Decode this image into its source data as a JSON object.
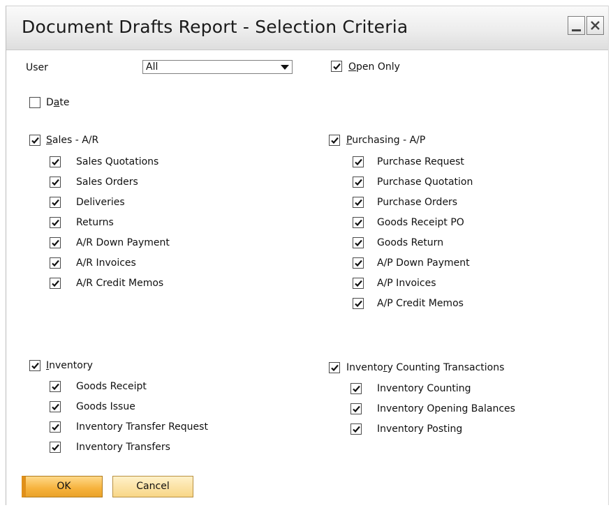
{
  "window": {
    "title": "Document Drafts Report - Selection Criteria",
    "minimize_icon": "minimize-icon",
    "close_icon": "close-icon"
  },
  "user": {
    "label": "User",
    "value": "All"
  },
  "open_only": {
    "label": "Open Only",
    "checked": true
  },
  "date": {
    "label": "Date",
    "checked": false
  },
  "sales": {
    "label": "Sales - A/R",
    "checked": true,
    "items": [
      {
        "label": "Sales Quotations",
        "checked": true
      },
      {
        "label": "Sales Orders",
        "checked": true
      },
      {
        "label": "Deliveries",
        "checked": true
      },
      {
        "label": "Returns",
        "checked": true
      },
      {
        "label": "A/R Down Payment",
        "checked": true
      },
      {
        "label": "A/R Invoices",
        "checked": true
      },
      {
        "label": "A/R Credit Memos",
        "checked": true
      }
    ]
  },
  "purchasing": {
    "label": "Purchasing - A/P",
    "checked": true,
    "items": [
      {
        "label": "Purchase Request",
        "checked": true
      },
      {
        "label": "Purchase Quotation",
        "checked": true
      },
      {
        "label": "Purchase Orders",
        "checked": true
      },
      {
        "label": "Goods Receipt PO",
        "checked": true
      },
      {
        "label": "Goods Return",
        "checked": true
      },
      {
        "label": "A/P Down Payment",
        "checked": true
      },
      {
        "label": "A/P Invoices",
        "checked": true
      },
      {
        "label": "A/P Credit Memos",
        "checked": true
      }
    ]
  },
  "inventory": {
    "label": "Inventory",
    "checked": true,
    "items": [
      {
        "label": "Goods Receipt",
        "checked": true
      },
      {
        "label": "Goods Issue",
        "checked": true
      },
      {
        "label": "Inventory Transfer Request",
        "checked": true
      },
      {
        "label": "Inventory Transfers",
        "checked": true
      }
    ]
  },
  "counting": {
    "label": "Inventory Counting Transactions",
    "checked": true,
    "items": [
      {
        "label": "Inventory Counting",
        "checked": true
      },
      {
        "label": "Inventory Opening Balances",
        "checked": true
      },
      {
        "label": "Inventory Posting",
        "checked": true
      }
    ]
  },
  "buttons": {
    "ok": "OK",
    "cancel": "Cancel"
  },
  "colors": {
    "ok_button": "#f6b23c",
    "cancel_button": "#f8d686"
  }
}
